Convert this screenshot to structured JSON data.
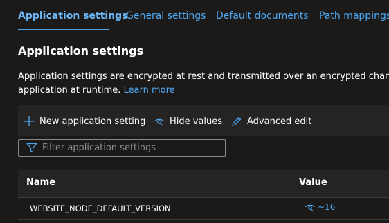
{
  "tabs": [
    {
      "label": "Application settings",
      "active": true
    },
    {
      "label": "General settings",
      "active": false
    },
    {
      "label": "Default documents",
      "active": false
    },
    {
      "label": "Path mappings",
      "active": false
    }
  ],
  "section": {
    "title": "Application settings",
    "description_line1": "Application settings are encrypted at rest and transmitted over an encrypted channel. Y",
    "description_line2": "application at runtime.",
    "learn_more": "Learn more"
  },
  "toolbar": {
    "new_label": "New application setting",
    "new_icon": "plus-icon",
    "hide_label": "Hide values",
    "hide_icon": "eye-hidden-icon",
    "edit_label": "Advanced edit",
    "edit_icon": "pencil-icon"
  },
  "filter": {
    "placeholder": "Filter application settings",
    "value": "",
    "icon": "funnel-icon"
  },
  "grid": {
    "columns": [
      "Name",
      "Value"
    ],
    "rows": [
      {
        "name": "WEBSITE_NODE_DEFAULT_VERSION",
        "value": "~16",
        "value_icon": "eye-hidden-icon"
      }
    ]
  },
  "colors": {
    "background": "#1b1a19",
    "accent": "#4fa7f0",
    "command_bar": "#252423",
    "border": "#8a8886"
  }
}
